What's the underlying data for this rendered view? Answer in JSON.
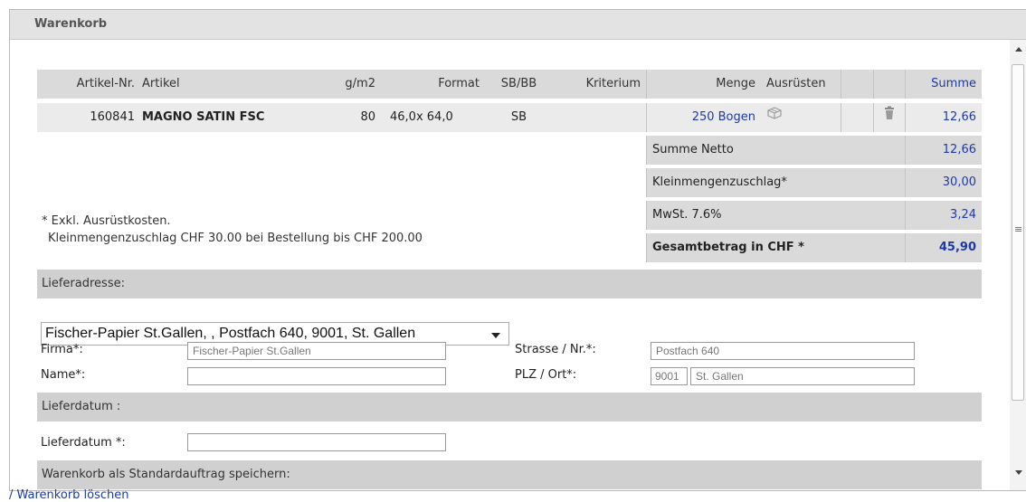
{
  "panel": {
    "title": "Warenkorb"
  },
  "table": {
    "headers": {
      "artnr": "Artikel-Nr.",
      "artikel": "Artikel",
      "gm2": "g/m2",
      "format": "Format",
      "sbbb": "SB/BB",
      "kriterium": "Kriterium",
      "menge": "Menge",
      "ausruesten": "Ausrüsten",
      "summe": "Summe"
    },
    "row": {
      "artnr": "160841",
      "artikel": "MAGNO SATIN FSC",
      "gm2": "80",
      "format": "46,0x 64,0",
      "sbbb": "SB",
      "kriterium": "",
      "menge": "250 Bogen",
      "summe": "12,66"
    }
  },
  "totals": {
    "netto_label": "Summe Netto",
    "netto_value": "12,66",
    "zuschlag_label": "Kleinmengenzuschlag*",
    "zuschlag_value": "30,00",
    "mwst_label": "MwSt. 7.6%",
    "mwst_value": "3,24",
    "gesamt_label": "Gesamtbetrag in CHF *",
    "gesamt_value": "45,90"
  },
  "notes": {
    "line1": "* Exkl. Ausrüstkosten.",
    "line2": "Kleinmengenzuschlag CHF 30.00 bei Bestellung bis CHF 200.00"
  },
  "lieferadresse": {
    "section_label": "Lieferadresse:",
    "selected": "Fischer-Papier St.Gallen, , Postfach 640, 9001, St. Gallen",
    "firma_label": "Firma*:",
    "firma_value": "Fischer-Papier St.Gallen",
    "name_label": "Name*:",
    "name_value": "",
    "strasse_label": "Strasse / Nr.*:",
    "strasse_value": "Postfach 640",
    "plzort_label": "PLZ / Ort*:",
    "plz_value": "9001",
    "ort_value": "St. Gallen"
  },
  "lieferdatum": {
    "section_label": "Lieferdatum :",
    "field_label": "Lieferdatum *:",
    "field_value": ""
  },
  "standardauftrag": {
    "section_label": "Warenkorb als Standardauftrag speichern:"
  },
  "footer": {
    "link": "/ Warenkorb löschen"
  },
  "icons": {
    "ausruesten": "box-icon",
    "delete": "trash-icon"
  }
}
